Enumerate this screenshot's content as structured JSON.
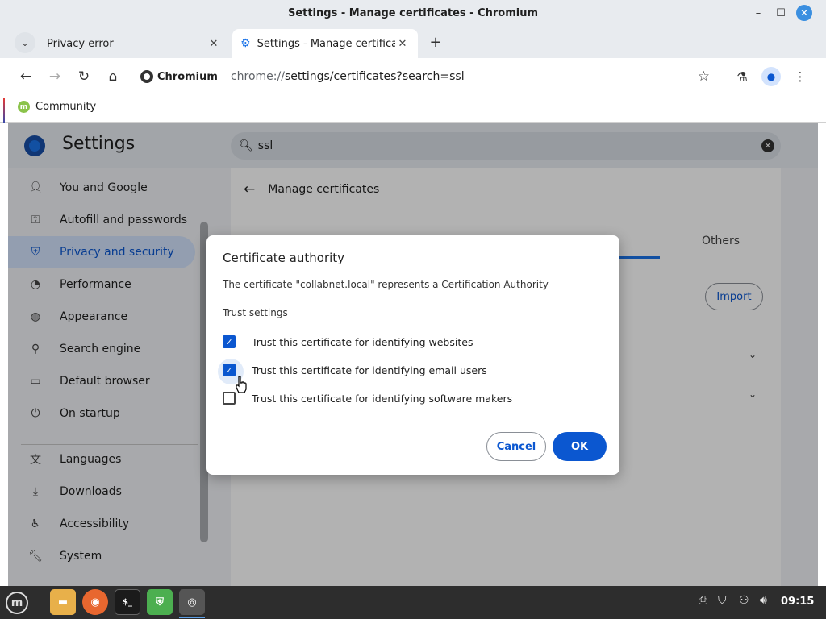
{
  "window": {
    "title": "Settings - Manage certificates - Chromium"
  },
  "tabs": [
    {
      "label": "Privacy error",
      "active": false
    },
    {
      "label": "Settings - Manage certificates",
      "active": true
    }
  ],
  "toolbar": {
    "site_chip": "Chromium",
    "url_host": "chrome://",
    "url_path": "settings/certificates?search=ssl"
  },
  "bookmarks": [
    {
      "label": "Community"
    }
  ],
  "settings": {
    "title": "Settings",
    "search_value": "ssl",
    "sidebar": [
      {
        "label": "You and Google",
        "icon": "person-icon"
      },
      {
        "label": "Autofill and passwords",
        "icon": "key-icon"
      },
      {
        "label": "Privacy and security",
        "icon": "shield-icon",
        "active": true
      },
      {
        "label": "Performance",
        "icon": "speedometer-icon"
      },
      {
        "label": "Appearance",
        "icon": "palette-icon"
      },
      {
        "label": "Search engine",
        "icon": "search-icon"
      },
      {
        "label": "Default browser",
        "icon": "browser-icon"
      },
      {
        "label": "On startup",
        "icon": "power-icon"
      },
      {
        "label": "Languages",
        "icon": "translate-icon"
      },
      {
        "label": "Downloads",
        "icon": "download-icon"
      },
      {
        "label": "Accessibility",
        "icon": "accessibility-icon"
      },
      {
        "label": "System",
        "icon": "wrench-icon"
      }
    ],
    "content": {
      "heading": "Manage certificates",
      "others_tab": "Others",
      "import_label": "Import"
    }
  },
  "dialog": {
    "title": "Certificate authority",
    "description": "The certificate \"collabnet.local\" represents a Certification Authority",
    "subheading": "Trust settings",
    "options": [
      {
        "label": "Trust this certificate for identifying websites",
        "checked": true
      },
      {
        "label": "Trust this certificate for identifying email users",
        "checked": true
      },
      {
        "label": "Trust this certificate for identifying software makers",
        "checked": false
      }
    ],
    "cancel_label": "Cancel",
    "ok_label": "OK"
  },
  "taskbar": {
    "clock": "09:15"
  },
  "colors": {
    "accent": "#0b57d0",
    "active_nav_bg": "#d3e3fd",
    "taskbar_bg": "#2d2d2d"
  }
}
